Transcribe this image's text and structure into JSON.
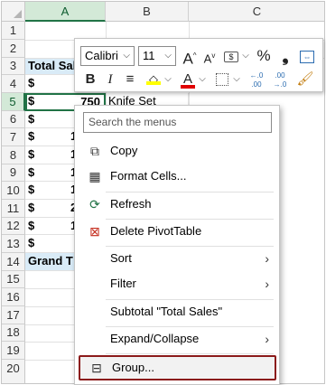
{
  "grid": {
    "columns": [
      {
        "label": "A",
        "selected": true
      },
      {
        "label": "B",
        "selected": false
      },
      {
        "label": "C",
        "selected": false
      }
    ],
    "rows": [
      "1",
      "2",
      "3",
      "4",
      "5",
      "6",
      "7",
      "8",
      "9",
      "10",
      "11",
      "12",
      "13",
      "14",
      "15",
      "16",
      "17",
      "18",
      "19",
      "20"
    ],
    "selected_row": "5",
    "cells": {
      "a3": "Total Sal",
      "a4": "$",
      "a5": "$",
      "b5_value": "750",
      "b5_text": "Knife Set",
      "a6": "$",
      "a7": "$",
      "a7_num": "1",
      "a8": "$",
      "a8_num": "1",
      "a9": "$",
      "a9_num": "1",
      "a10": "$",
      "a10_num": "1",
      "a11": "$",
      "a11_num": "2",
      "a12": "$",
      "a12_num": "1",
      "a13": "$",
      "a14": "Grand T"
    }
  },
  "mini_toolbar": {
    "font_name": "Calibri",
    "font_size": "11",
    "grow_font": "A",
    "shrink_font": "A",
    "percent": "%",
    "comma": "❟",
    "bold": "B",
    "italic": "I",
    "font_color_letter": "A",
    "dec_increase": "←.0 .00",
    "dec_decrease": ".00 →.0"
  },
  "context_menu": {
    "search_placeholder": "Search the menus",
    "items": [
      {
        "label": "Copy",
        "icon": "copy-icon"
      },
      {
        "label": "Format Cells...",
        "icon": "format-cells-icon"
      },
      {
        "label": "Refresh",
        "icon": "refresh-icon"
      },
      {
        "label": "Delete PivotTable",
        "icon": "delete-pivottable-icon"
      },
      {
        "label": "Sort",
        "submenu": true
      },
      {
        "label": "Filter",
        "submenu": true
      },
      {
        "label": "Subtotal \"Total Sales\""
      },
      {
        "label": "Expand/Collapse",
        "submenu": true
      },
      {
        "label": "Group...",
        "icon": "group-icon",
        "highlighted": true
      }
    ]
  },
  "colors": {
    "selection_green": "#217346",
    "pivot_header_fill": "#d9ebf7",
    "highlight_border": "#8b1a1a"
  }
}
